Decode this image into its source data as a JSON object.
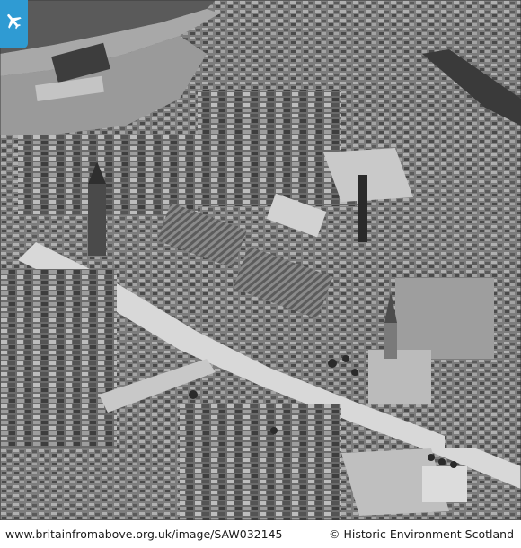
{
  "photo": {
    "description_icon": "aerial-photograph",
    "badge_icon": "airplane-icon",
    "badge_color": "#2f9bd3"
  },
  "footer": {
    "url": "www.britainfromabove.org.uk/image/SAW032145",
    "credit": "© Historic Environment Scotland"
  }
}
